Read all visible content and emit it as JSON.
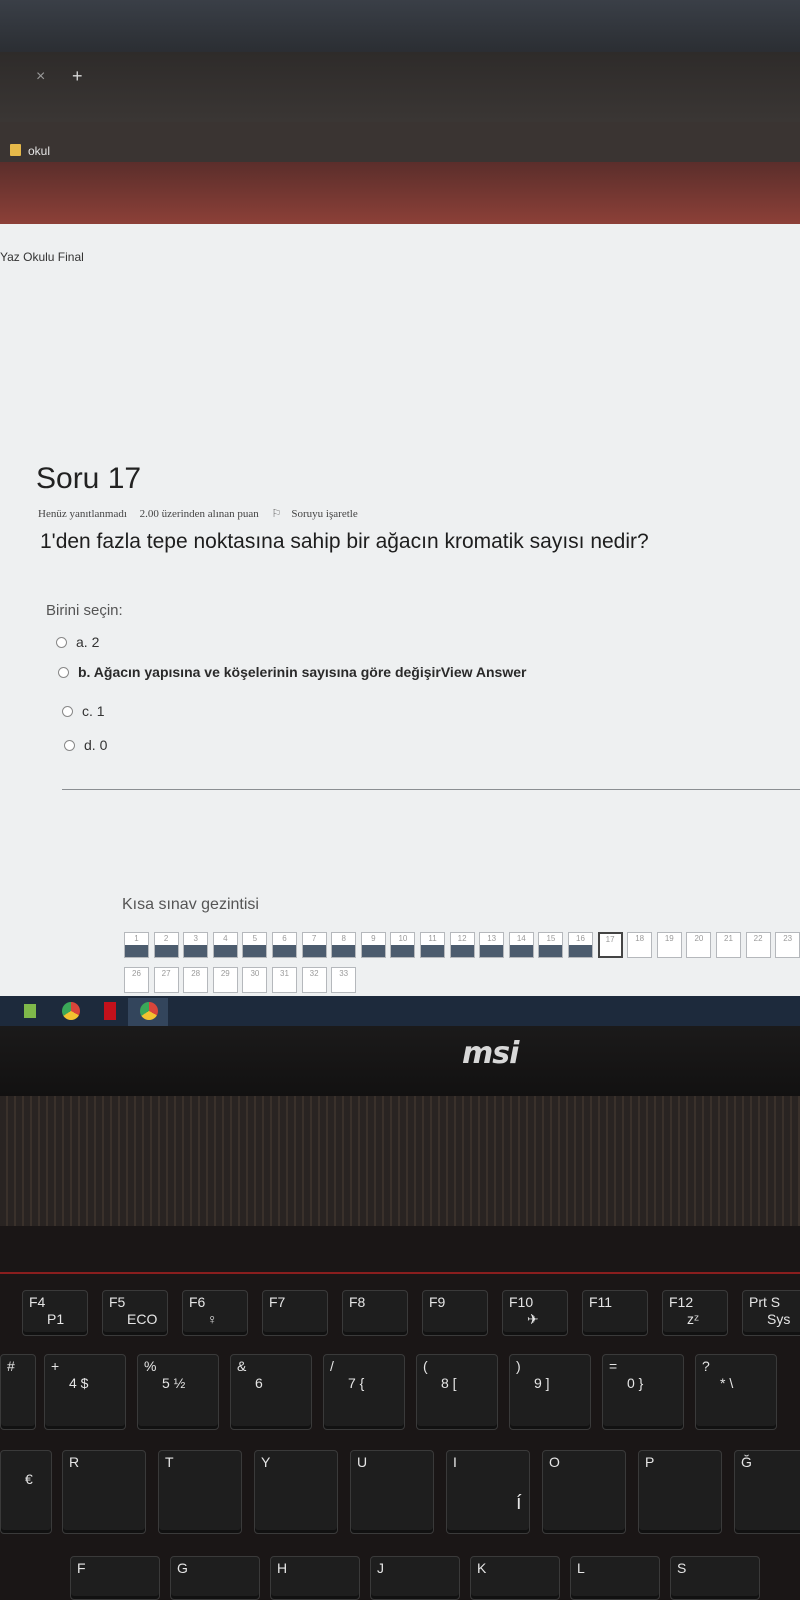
{
  "browser": {
    "tab_close": "×",
    "tab_new": "+",
    "bookmark_label": "okul"
  },
  "page": {
    "course_title": "Yaz Okulu Final"
  },
  "question": {
    "title": "Soru 17",
    "status": "Henüz yanıtlanmadı",
    "points": "2.00 üzerinden alınan puan",
    "flag_label": "Soruyu işaretle",
    "text": "1'den fazla tepe noktasına sahip bir ağacın kromatik sayısı nedir?",
    "choose_label": "Birini seçin:",
    "options": [
      "a. 2",
      "b. Ağacın yapısına ve köşelerinin sayısına göre değişirView Answer",
      "c. 1",
      "d. 0"
    ]
  },
  "navigation": {
    "title": "Kısa sınav gezintisi",
    "row1": [
      "1",
      "2",
      "3",
      "4",
      "5",
      "6",
      "7",
      "8",
      "9",
      "10",
      "11",
      "12",
      "13",
      "14",
      "15",
      "16",
      "17",
      "18",
      "19",
      "20",
      "21",
      "22",
      "23"
    ],
    "row2": [
      "26",
      "27",
      "28",
      "29",
      "30",
      "31",
      "32",
      "33"
    ],
    "current": "17",
    "answered": [
      "1",
      "2",
      "3",
      "4",
      "5",
      "6",
      "7",
      "8",
      "9",
      "10",
      "11",
      "12",
      "13",
      "14",
      "15",
      "16"
    ]
  },
  "laptop": {
    "brand": "msi"
  },
  "keyboard": {
    "fn_row": [
      {
        "top": "F4",
        "sub": "P1"
      },
      {
        "top": "F5",
        "sub": "ECO"
      },
      {
        "top": "F6",
        "sub": "♀"
      },
      {
        "top": "F7",
        "sub": ""
      },
      {
        "top": "F8",
        "sub": ""
      },
      {
        "top": "F9",
        "sub": ""
      },
      {
        "top": "F10",
        "sub": "✈"
      },
      {
        "top": "F11",
        "sub": ""
      },
      {
        "top": "F12",
        "sub": "zᶻ"
      },
      {
        "top": "Prt S",
        "sub": "Sys"
      }
    ],
    "num_row": [
      {
        "top": "+",
        "sub": "4  $"
      },
      {
        "top": "%",
        "sub": "5 ½"
      },
      {
        "top": "&",
        "sub": "6"
      },
      {
        "top": "/",
        "sub": "7 {"
      },
      {
        "top": "(",
        "sub": "8 ["
      },
      {
        "top": ")",
        "sub": "9 ]"
      },
      {
        "top": "=",
        "sub": "0 }"
      },
      {
        "top": "?",
        "sub": "* \\"
      }
    ],
    "left_hash": "#",
    "letter_row": [
      "R",
      "T",
      "Y",
      "U",
      "I",
      "O",
      "P",
      "Ğ"
    ],
    "euro": "€",
    "i_dot": "í",
    "bottom_row": [
      "F",
      "G",
      "H",
      "J",
      "K",
      "L",
      "S"
    ]
  }
}
